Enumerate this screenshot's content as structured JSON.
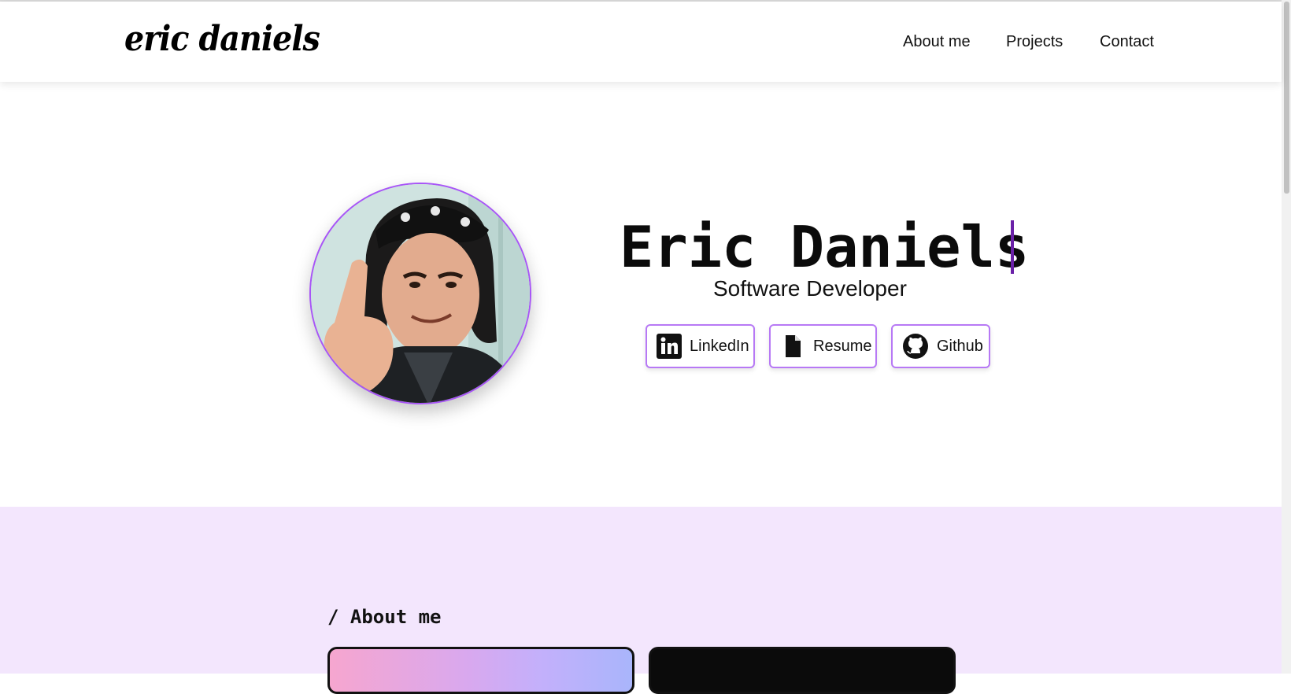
{
  "header": {
    "logo": "eric daniels",
    "nav": [
      "About me",
      "Projects",
      "Contact"
    ]
  },
  "hero": {
    "name": "Eric Daniels",
    "role": "Software Developer",
    "buttons": [
      {
        "label": "LinkedIn",
        "icon": "linkedin-icon"
      },
      {
        "label": "Resume",
        "icon": "document-icon"
      },
      {
        "label": "Github",
        "icon": "github-icon"
      }
    ],
    "avatar_alt": "profile-photo"
  },
  "about": {
    "title": "/ About me"
  },
  "colors": {
    "accent": "#a855f7",
    "caret": "#6b21a8",
    "section_bg": "#f3e6fd"
  }
}
